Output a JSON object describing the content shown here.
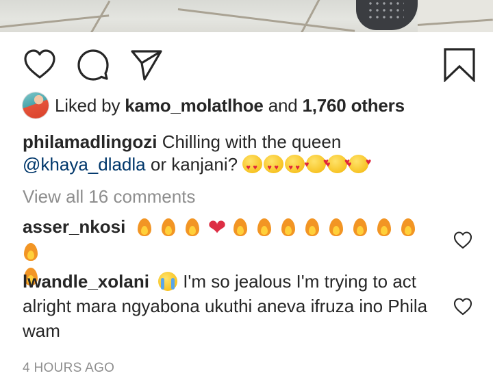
{
  "post": {
    "actions": {
      "like_icon": "heart-outline-icon",
      "comment_icon": "speech-bubble-icon",
      "share_icon": "paper-plane-icon",
      "save_icon": "bookmark-icon"
    },
    "likes": {
      "prefix": "Liked by",
      "user": "kamo_molatlhoe",
      "middle": "and",
      "others": "1,760 others"
    },
    "caption": {
      "username": "philamadlingozi",
      "text": "Chilling with the queen",
      "mention": "@khaya_dladla",
      "text_after": "or kanjani?"
    },
    "view_all_comments": "View all 16 comments",
    "comments": [
      {
        "username": "asser_nkosi",
        "content": "fire and red heart emoji"
      },
      {
        "username": "lwandle_xolani",
        "text": "I'm so jealous I'm trying to act alright mara ngyabona ukuthi aneva ifruza ino Phila wam"
      }
    ],
    "timestamp": "4 HOURS AGO",
    "colors": {
      "text": "#262626",
      "secondary": "#8e8e8e",
      "mention": "#00376b"
    }
  }
}
